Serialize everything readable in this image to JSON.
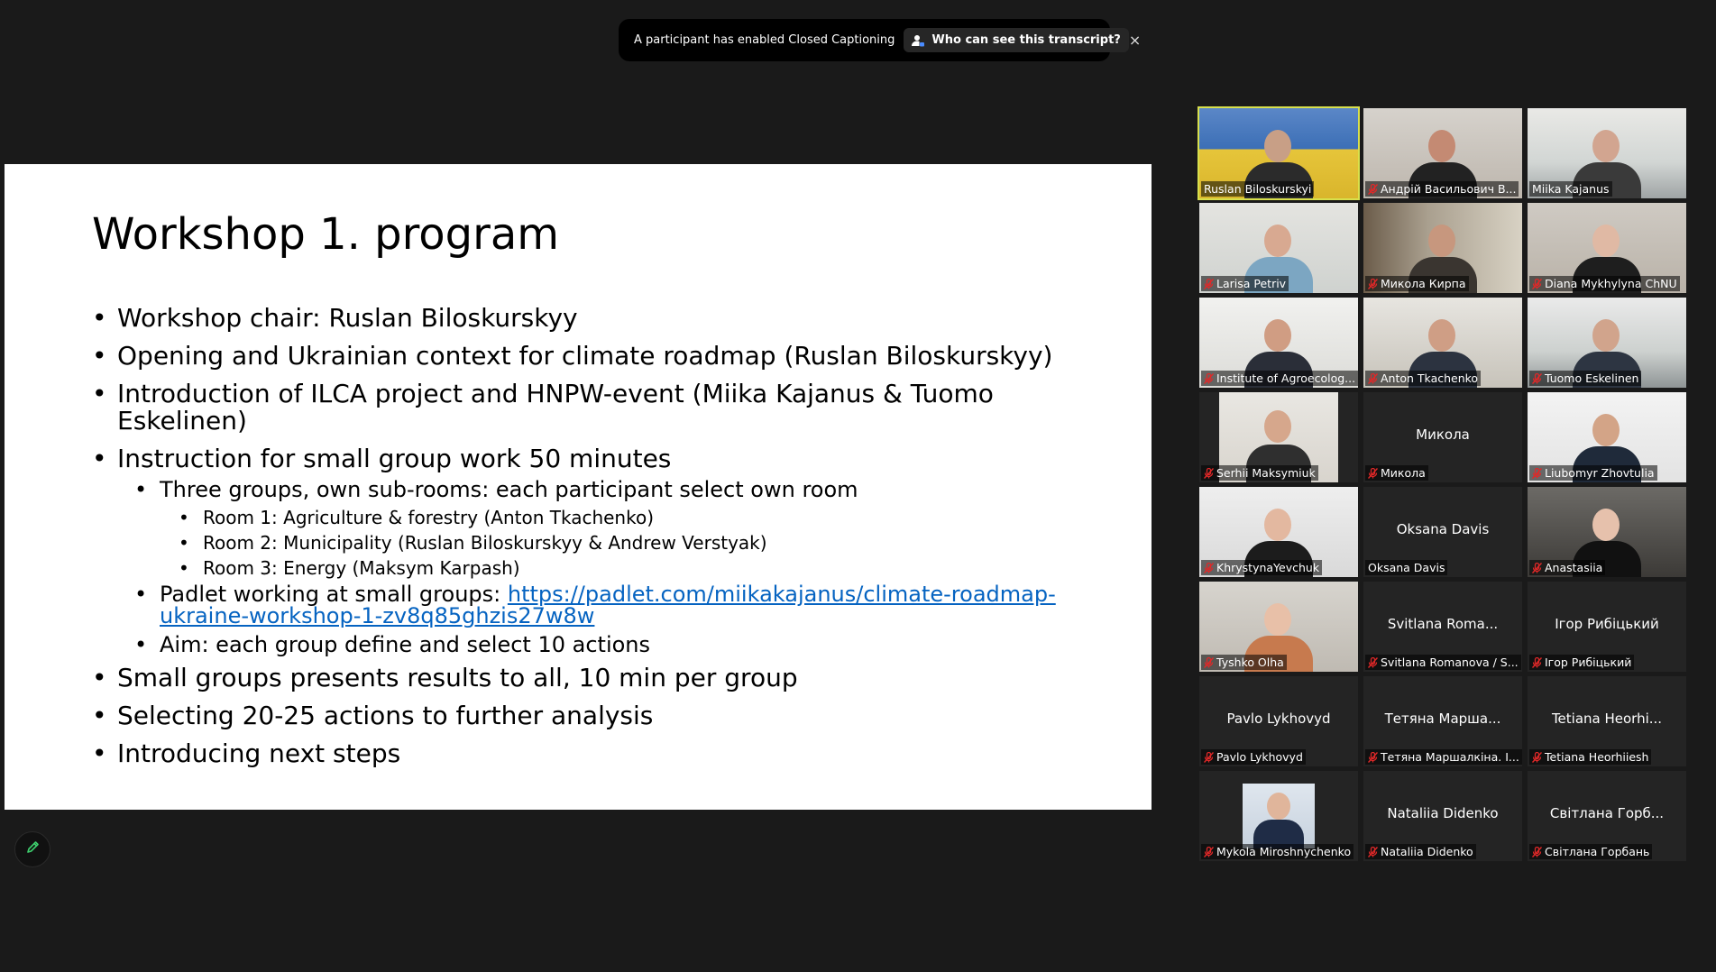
{
  "caption_banner": {
    "message": "A participant has enabled Closed Captioning",
    "button_label": "Who can see this transcript?",
    "close_glyph": "×"
  },
  "slide": {
    "title": "Workshop 1. program",
    "bullets": {
      "b1": "Workshop chair: Ruslan Biloskurskyy",
      "b2": "Opening and Ukrainian context for climate roadmap (Ruslan Biloskurskyy)",
      "b3_line1": "Introduction of ILCA project and HNPW-event (Miika Kajanus & Tuomo",
      "b3_line2": "Eskelinen)",
      "b4": "Instruction for small group work 50 minutes",
      "b4_sub1": "Three groups, own sub-rooms: each participant select own room",
      "room1": "Room 1: Agriculture & forestry (Anton Tkachenko)",
      "room2": "Room 2: Municipality (Ruslan Biloskurskyy & Andrew Verstyak)",
      "room3": "Room 3: Energy (Maksym Karpash)",
      "padlet_prefix": "Padlet working at small groups: ",
      "padlet_link_line1": "https://padlet.com/miikakajanus/climate-roadmap-",
      "padlet_link_line2": "ukraine-workshop-1-zv8q85ghzis27w8w",
      "aim": "Aim: each group define and select 10 actions",
      "b5": "Small groups presents results to all, 10 min per group",
      "b6": "Selecting 20-25 actions to further analysis",
      "b7": "Introducing next steps"
    },
    "bullet_glyph": "•"
  },
  "annotate_button": {
    "icon": "pencil-icon"
  },
  "gallery": {
    "active_color": "#d8e04c",
    "mute_color": "#e02828",
    "participants": [
      {
        "name": "Ruslan Biloskurskyi",
        "big": "",
        "muted": false
      },
      {
        "name": "Андрій Васильович В...",
        "big": "",
        "muted": true
      },
      {
        "name": "Miika Kajanus",
        "big": "",
        "muted": false
      },
      {
        "name": "Larisa Petriv",
        "big": "",
        "muted": true
      },
      {
        "name": "Микола Кирпа",
        "big": "",
        "muted": true
      },
      {
        "name": "Diana Mykhylyna ChNU",
        "big": "",
        "muted": true
      },
      {
        "name": "Institute of Agroecolog...",
        "big": "",
        "muted": true
      },
      {
        "name": "Anton Tkachenko",
        "big": "",
        "muted": true
      },
      {
        "name": "Tuomo Eskelinen",
        "big": "",
        "muted": true
      },
      {
        "name": "Serhii Maksymiuk",
        "big": "",
        "muted": true
      },
      {
        "name": "Микола",
        "big": "Микола",
        "muted": true
      },
      {
        "name": "Liubomyr Zhovtulia",
        "big": "",
        "muted": true
      },
      {
        "name": "KhrystynaYevchuk",
        "big": "",
        "muted": true
      },
      {
        "name": "Oksana Davis",
        "big": "Oksana Davis",
        "muted": false
      },
      {
        "name": "Anastasiia",
        "big": "",
        "muted": true
      },
      {
        "name": "Tyshko Olha",
        "big": "",
        "muted": true
      },
      {
        "name": "Svitlana Romanova / S...",
        "big": "Svitlana Roma...",
        "muted": true
      },
      {
        "name": "Ігор Рибіцький",
        "big": "Ігор Рибіцький",
        "muted": true
      },
      {
        "name": "Pavlo Lykhovyd",
        "big": "Pavlo Lykhovyd",
        "muted": true
      },
      {
        "name": "Тетяна Маршалкіна. І...",
        "big": "Тетяна Марша...",
        "muted": true
      },
      {
        "name": "Tetiana Heorhiiesh",
        "big": "Tetiana Heorhi...",
        "muted": true
      },
      {
        "name": "Mykola Miroshnychenko",
        "big": "",
        "muted": true
      },
      {
        "name": "Nataliia Didenko",
        "big": "Nataliia Didenko",
        "muted": true
      },
      {
        "name": "Світлана Горбань",
        "big": "Світлана Горб...",
        "muted": true
      }
    ]
  }
}
